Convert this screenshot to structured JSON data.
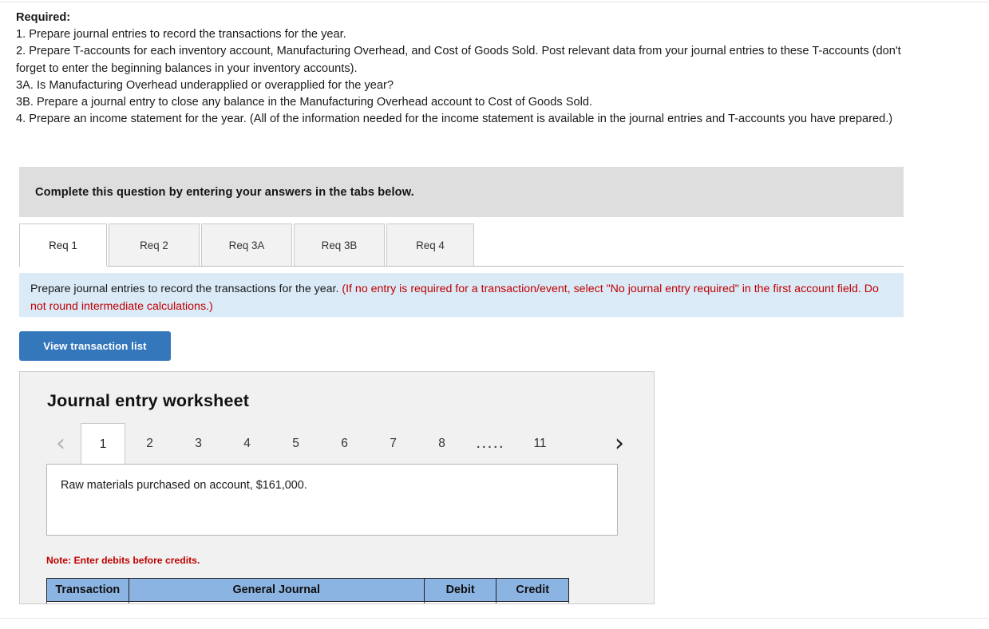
{
  "required": {
    "title": "Required:",
    "lines": [
      "1. Prepare journal entries to record the transactions for the year.",
      "2. Prepare T-accounts for each inventory account, Manufacturing Overhead, and Cost of Goods Sold. Post relevant data from your journal entries to these T-accounts (don't forget to enter the beginning balances in your inventory accounts).",
      "3A. Is Manufacturing Overhead underapplied or overapplied for the year?",
      "3B. Prepare a journal entry to close any balance in the Manufacturing Overhead account to Cost of Goods Sold.",
      "4. Prepare an income statement for the year. (All of the information needed for the income statement is available in the journal entries and T-accounts you have prepared.)"
    ]
  },
  "complete_banner": {
    "text": "Complete this question by entering your answers in the tabs below."
  },
  "tabs": {
    "items": [
      {
        "label": "Req 1",
        "active": true
      },
      {
        "label": "Req 2",
        "active": false
      },
      {
        "label": "Req 3A",
        "active": false
      },
      {
        "label": "Req 3B",
        "active": false
      },
      {
        "label": "Req 4",
        "active": false
      }
    ]
  },
  "instruction": {
    "black_text": "Prepare journal entries to record the transactions for the year.",
    "red_text": "(If no entry is required for a transaction/event, select \"No journal entry required\" in the first account field. Do not round intermediate calculations.)"
  },
  "buttons": {
    "view_transaction_list": "View transaction list"
  },
  "worksheet": {
    "title": "Journal entry worksheet",
    "pager": {
      "prev_icon": "chevron-left-icon",
      "next_icon": "chevron-right-icon",
      "pages": [
        "1",
        "2",
        "3",
        "4",
        "5",
        "6",
        "7",
        "8"
      ],
      "ellipsis": ".....",
      "last_page": "11",
      "active_page": "1"
    },
    "transaction_text": "Raw materials purchased on account, $161,000.",
    "note": "Note: Enter debits before credits.",
    "table": {
      "headers": [
        "Transaction",
        "General Journal",
        "Debit",
        "Credit"
      ],
      "rows": [
        {
          "transaction": "",
          "general_journal": "",
          "debit": "",
          "credit": ""
        }
      ]
    }
  },
  "colors": {
    "accent_blue": "#3477bb",
    "table_header_blue": "#8cb4e3",
    "instruction_bg": "#daeaf7",
    "banner_gray": "#dedede",
    "red_text": "#c00000"
  }
}
